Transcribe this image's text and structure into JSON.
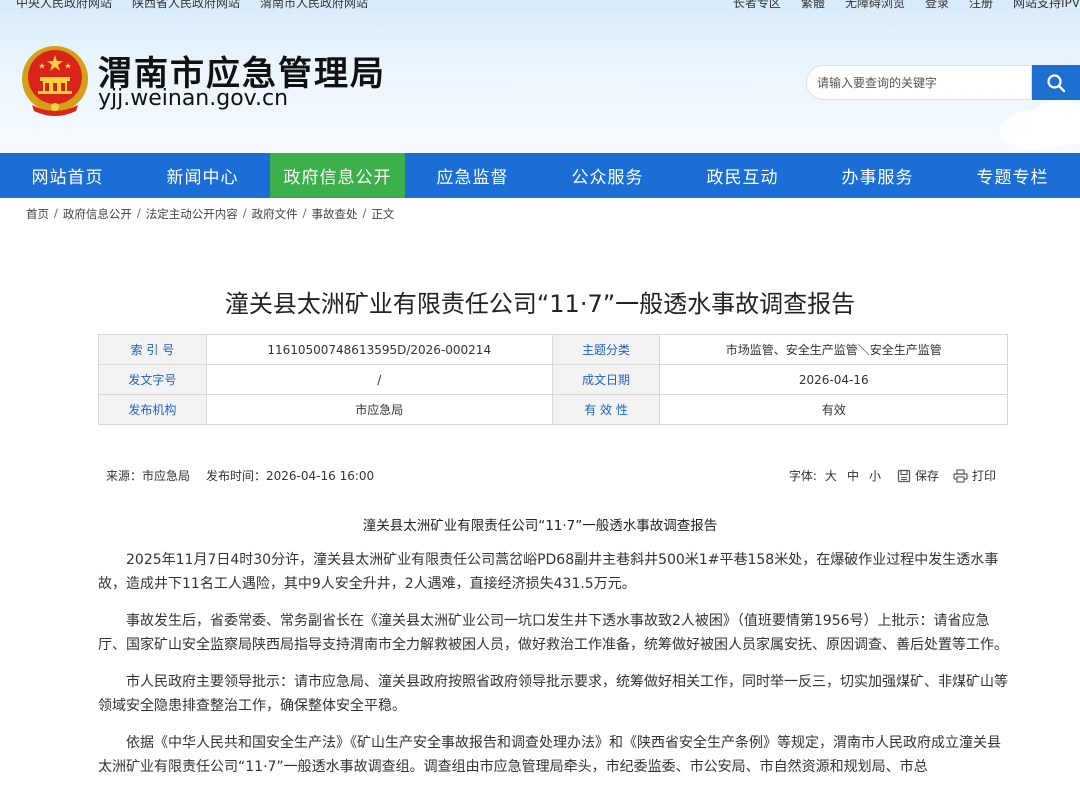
{
  "topbar": {
    "left_links": [
      "中央人民政府网站",
      "陕西省人民政府网站",
      "渭南市人民政府网站"
    ],
    "right_links": [
      "长者专区",
      "繁體",
      "无障碍浏览",
      "登录",
      "注册",
      "网站支持IPV"
    ]
  },
  "site": {
    "title": "渭南市应急管理局",
    "domain": "yjj.weinan.gov.cn"
  },
  "search": {
    "placeholder": "请输入要查询的关键字"
  },
  "nav": {
    "items": [
      "网站首页",
      "新闻中心",
      "政府信息公开",
      "应急监督",
      "公众服务",
      "政民互动",
      "办事服务",
      "专题专栏"
    ],
    "active_index": 2
  },
  "breadcrumb": [
    "首页",
    "政府信息公开",
    "法定主动公开内容",
    "政府文件",
    "事故查处",
    "正文"
  ],
  "article": {
    "title": "潼关县太洲矿业有限责任公司“11·7”一般透水事故调查报告"
  },
  "meta": {
    "rows": [
      {
        "k1": "索 引 号",
        "v1": "11610500748613595D/2026-000214",
        "k2": "主题分类",
        "v2": "市场监管、安全生产监管＼安全生产监管"
      },
      {
        "k1": "发文字号",
        "v1": "/",
        "k2": "成文日期",
        "v2": "2026-04-16"
      },
      {
        "k1": "发布机构",
        "v1": "市应急局",
        "k2": "有 效 性",
        "v2": "有效"
      }
    ]
  },
  "source": {
    "from": "来源：市应急局",
    "time": "发布时间：2026-04-16 16:00",
    "font_label": "字体:",
    "font_large": "大",
    "font_medium": "中",
    "font_small": "小",
    "save": "保存",
    "print": "打印"
  },
  "content": {
    "heading": "潼关县太洲矿业有限责任公司“11·7”一般透水事故调查报告",
    "paragraphs": [
      "2025年11月7日4时30分许，潼关县太洲矿业有限责任公司蒿岔峪PD68副井主巷斜井500米1#平巷158米处，在爆破作业过程中发生透水事故，造成井下11名工人遇险，其中9人安全升井，2人遇难，直接经济损失431.5万元。",
      "事故发生后，省委常委、常务副省长在《潼关县太洲矿业公司一坑口发生井下透水事故致2人被困》（值班要情第1956号）上批示：请省应急厅、国家矿山安全监察局陕西局指导支持渭南市全力解救被困人员，做好救治工作准备，统筹做好被困人员家属安抚、原因调查、善后处置等工作。",
      "市人民政府主要领导批示：请市应急局、潼关县政府按照省政府领导批示要求，统筹做好相关工作，同时举一反三，切实加强煤矿、非煤矿山等领域安全隐患排查整治工作，确保整体安全平稳。",
      "依据《中华人民共和国安全生产法》《矿山生产安全事故报告和调查处理办法》和《陕西省安全生产条例》等规定，渭南市人民政府成立潼关县太洲矿业有限责任公司“11·7”一般透水事故调查组。调查组由市应急管理局牵头，市纪委监委、市公安局、市自然资源和规划局、市总"
    ]
  },
  "colors": {
    "nav_bg": "#1a6ed6",
    "nav_active": "#3cb04a",
    "meta_key_text": "#1d62c4"
  }
}
